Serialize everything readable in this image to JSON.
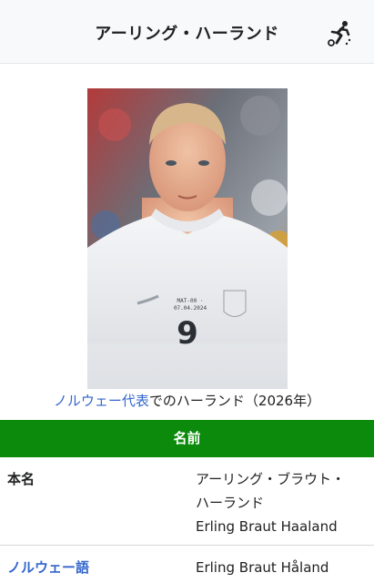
{
  "header": {
    "title": "アーリング・ハーランド",
    "icon": "football-player-icon"
  },
  "photo": {
    "shirt_number": "9",
    "shirt_print_1": "MAT-00 ·",
    "shirt_print_2": "07.04.2024"
  },
  "caption": {
    "link_text": "ノルウェー代表",
    "rest_text": "でのハーランド（2026年）"
  },
  "section": {
    "title": "名前"
  },
  "rows": [
    {
      "label": "本名",
      "value_lines": [
        "アーリング・ブラウト・",
        "ハーランド",
        "Erling Braut Haaland"
      ]
    },
    {
      "label": "ノルウェー語",
      "value": "Erling Braut Håland"
    }
  ],
  "colors": {
    "section_bar": "#0b8a0b",
    "link": "#3366cc",
    "header_bg": "#f8f9fa"
  }
}
